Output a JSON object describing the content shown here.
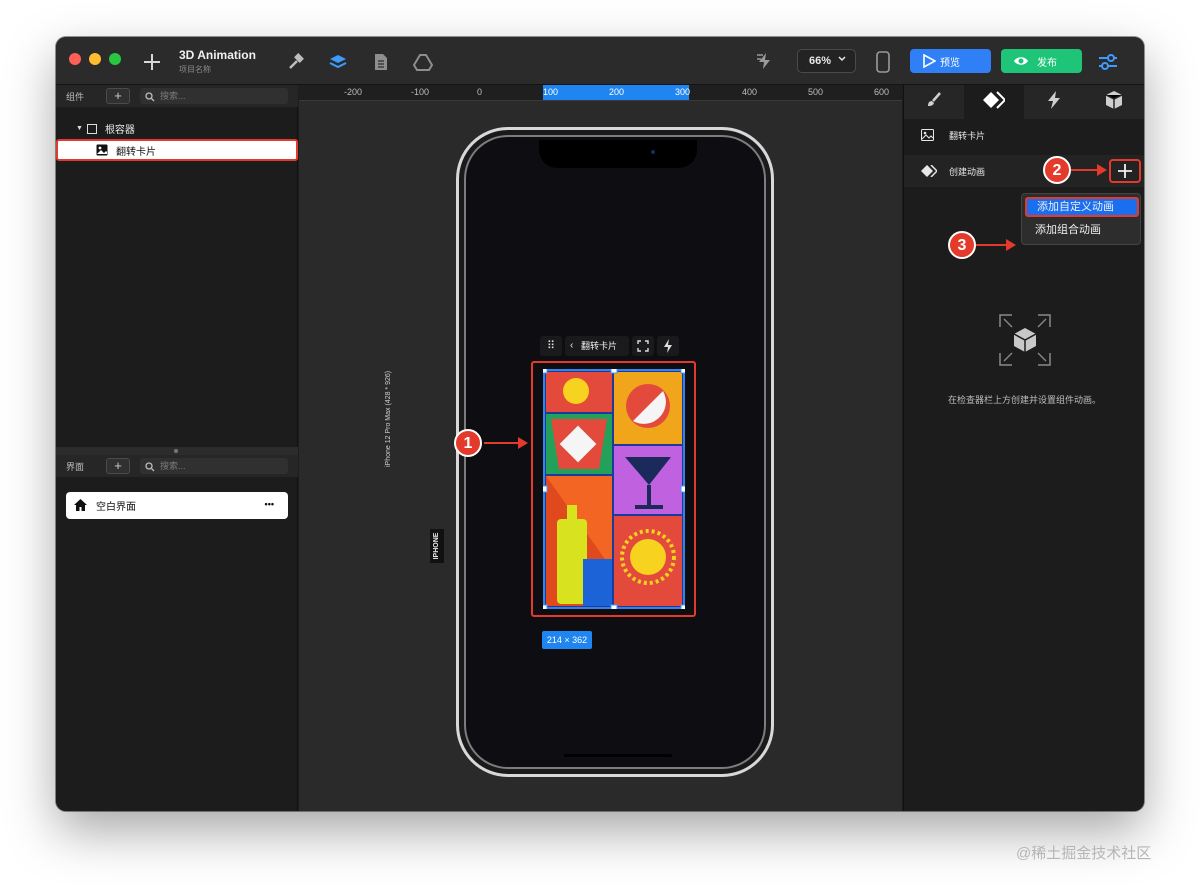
{
  "toolbar": {
    "project_title": "3D Animation",
    "project_subtitle": "项目名称",
    "zoom_value": "66%",
    "preview_label": "预览",
    "publish_label": "发布"
  },
  "components_panel": {
    "header_label": "组件",
    "search_placeholder": "搜索...",
    "root_label": "根容器",
    "selected_item_label": "翻转卡片"
  },
  "screens_panel": {
    "header_label": "界面",
    "search_placeholder": "搜索...",
    "screen_label": "空白界面",
    "more_label": "•••"
  },
  "canvas": {
    "ruler_labels": [
      "-200",
      "-100",
      "0",
      "100",
      "200",
      "300",
      "400",
      "500",
      "600"
    ],
    "device_label": "iPhone 12 Pro Max (428 * 926)",
    "device_tag": "IPHONE",
    "component_bar_label": "翻转卡片",
    "size_label": "214 × 362"
  },
  "inspector": {
    "component_name": "翻转卡片",
    "create_animation_label": "创建动画",
    "menu_items": [
      "添加自定义动画",
      "添加组合动画"
    ],
    "empty_hint": "在检查器栏上方创建并设置组件动画。"
  },
  "annotations": [
    "1",
    "2",
    "3"
  ],
  "watermark": "@稀土掘金技术社区",
  "colors": {
    "accent_blue": "#2f7ff7",
    "publish_green": "#1ec578",
    "annotation_red": "#e43a2c"
  }
}
